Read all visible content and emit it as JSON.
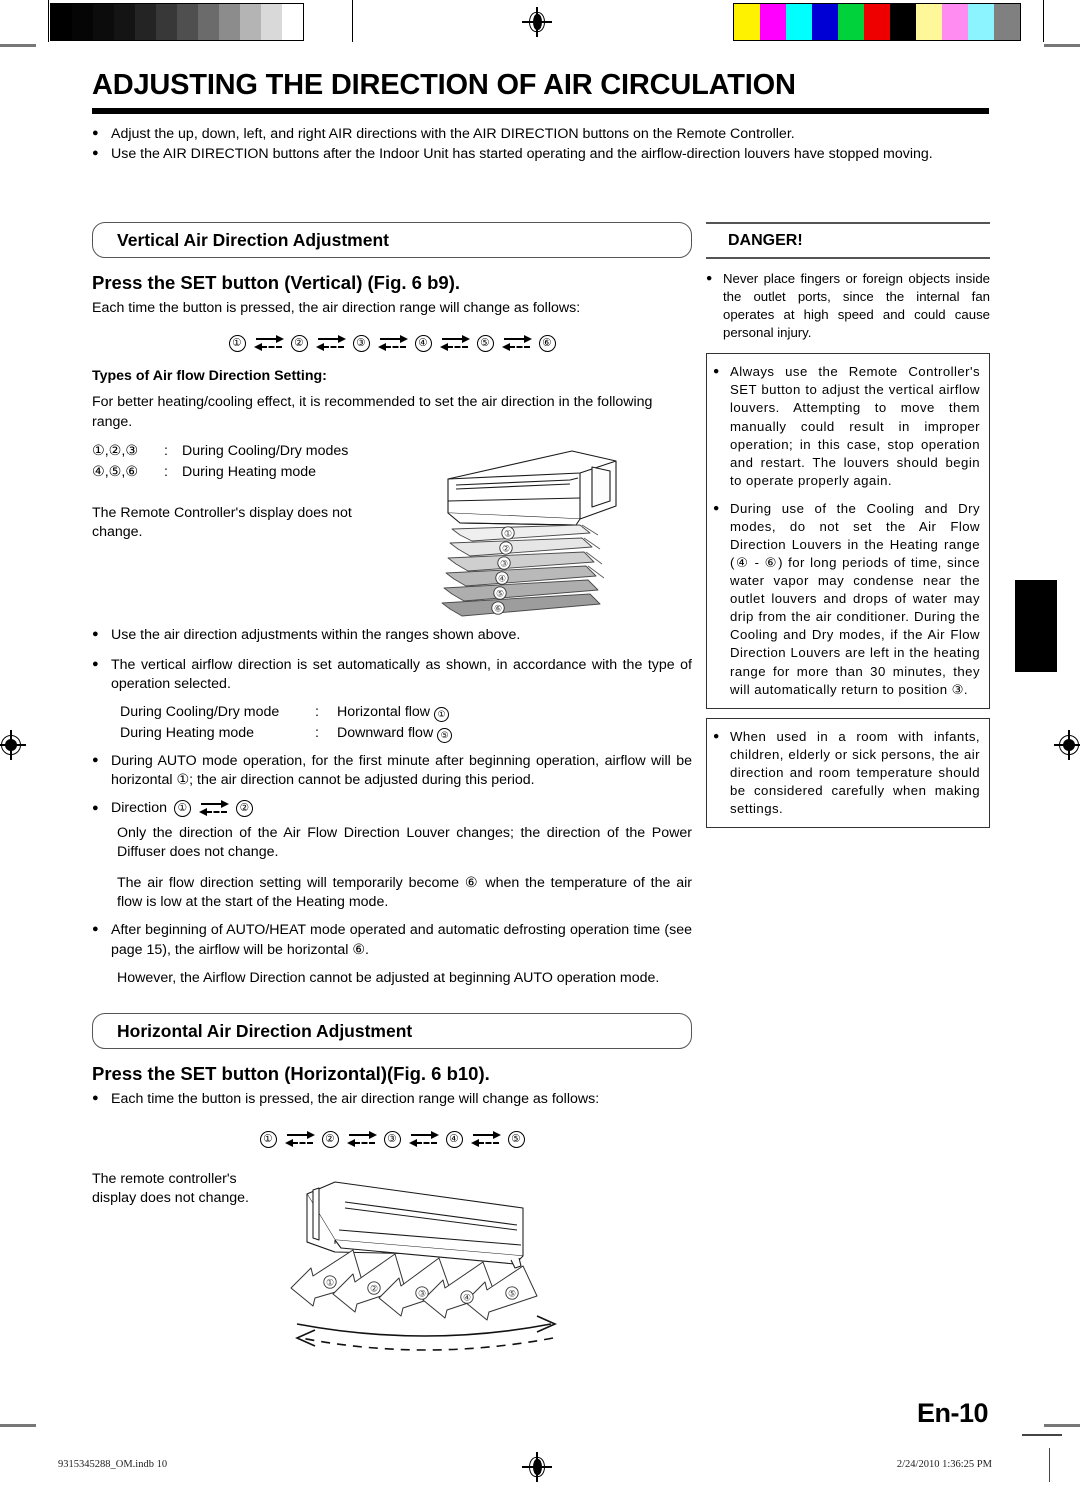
{
  "calibration": {
    "gray_steps": [
      "#000000",
      "#050505",
      "#0c0c0c",
      "#141414",
      "#242424",
      "#383838",
      "#4f4f4f",
      "#6b6b6b",
      "#8c8c8c",
      "#b4b4b4",
      "#d9d9d9",
      "#ffffff"
    ],
    "color_steps": [
      "#fff200",
      "#ff00ff",
      "#00ffff",
      "#0000d4",
      "#00d23c",
      "#ee0000",
      "#000000",
      "#fff89a",
      "#ff8cf0",
      "#8cf4ff",
      "#808080"
    ]
  },
  "header": {
    "title": "ADJUSTING THE DIRECTION OF AIR CIRCULATION",
    "intro_bullets": [
      "Adjust the up, down, left, and right AIR directions with the AIR DIRECTION buttons on the Remote Controller.",
      "Use the AIR DIRECTION buttons after the Indoor Unit has started operating and the airflow-direction louvers have stopped moving."
    ],
    "bullet_glyph": "●"
  },
  "vertical": {
    "section_title": "Vertical Air Direction Adjustment",
    "heading": "Press the SET button (Vertical) (Fig. 6 b9).",
    "lead": "Each time the button is pressed, the air direction range will change as follows:",
    "sequence": [
      "①",
      "②",
      "③",
      "④",
      "⑤",
      "⑥"
    ],
    "types_label": "Types of Air flow Direction Setting:",
    "types_intro": "For better heating/cooling effect, it is recommended to set the air direction in the following range.",
    "mode_rows": [
      {
        "keys": "①,②,③",
        "colon": ":",
        "value": "During Cooling/Dry modes"
      },
      {
        "keys": "④,⑤,⑥",
        "colon": ":",
        "value": "During Heating mode"
      }
    ],
    "remote_note": "The Remote Controller's display does not change.",
    "bullets": [
      "Use the air direction adjustments within the ranges shown above.",
      "The vertical airflow direction is set automatically as shown, in accordance with the type of operation selected."
    ],
    "flow_rows": [
      {
        "mode": "During Cooling/Dry mode",
        "colon": ":",
        "flow": "Horizontal flow",
        "num": "①"
      },
      {
        "mode": "During Heating mode",
        "colon": ":",
        "flow": "Downward flow",
        "num": "⑤"
      }
    ],
    "auto_bullet": "During AUTO mode operation, for the first minute after beginning operation, airflow will be horizontal ①; the air direction cannot be adjusted during this period.",
    "direction_label": "Direction",
    "direction_from": "①",
    "direction_to": "②",
    "louver_para": "Only the direction of the Air Flow Direction Louver changes; the direction of the Power Diffuser does not change.",
    "temp_para": "The air flow direction setting will temporarily become ⑥ when the temperature of the air flow is low at the start of the Heating mode.",
    "defrost_bullet": "After beginning of AUTO/HEAT mode operated and automatic defrosting operation time (see page 15), the airflow will be horizontal ⑥.",
    "however_para": "However, the Airflow Direction cannot be adjusted at beginning AUTO operation mode.",
    "diagram_labels": [
      "①",
      "②",
      "③",
      "④",
      "⑤",
      "⑥"
    ]
  },
  "horizontal": {
    "section_title": "Horizontal Air Direction Adjustment",
    "heading": "Press the SET button (Horizontal)(Fig. 6 b10).",
    "lead": "Each time the button is pressed, the air direction range will change as follows:",
    "sequence": [
      "①",
      "②",
      "③",
      "④",
      "⑤"
    ],
    "remote_note": "The remote controller's display does not change.",
    "diagram_labels": [
      "①",
      "②",
      "③",
      "④",
      "⑤"
    ]
  },
  "danger": {
    "title": "DANGER!",
    "bullet_glyph": "●",
    "first_bullet": "Never place fingers or foreign objects inside the outlet ports, since the internal fan operates at high speed and could cause personal injury.",
    "boxed_bullets": [
      "Always use the Remote Controller's SET button to adjust the vertical airflow louvers. Attempting to move them manually could result in improper operation; in this case, stop operation and restart. The louvers should begin to operate properly again.",
      "During use of the Cooling and Dry modes, do not set the Air Flow Direction Louvers in the Heating range (④ - ⑥) for long periods of time, since water vapor may condense near the outlet louvers and drops of water may drip from the air conditioner. During the Cooling and Dry modes, if the Air Flow Direction Louvers are left in the heating range for more than 30 minutes, they will automatically return to position ③."
    ],
    "last_boxed_bullet": "When used in a room with infants, children, elderly or sick persons, the air direction and room temperature should be considered carefully when making settings."
  },
  "footer": {
    "page_label": "En-10",
    "file_name": "9315345288_OM.indb   10",
    "timestamp": "2/24/2010   1:36:25 PM"
  }
}
